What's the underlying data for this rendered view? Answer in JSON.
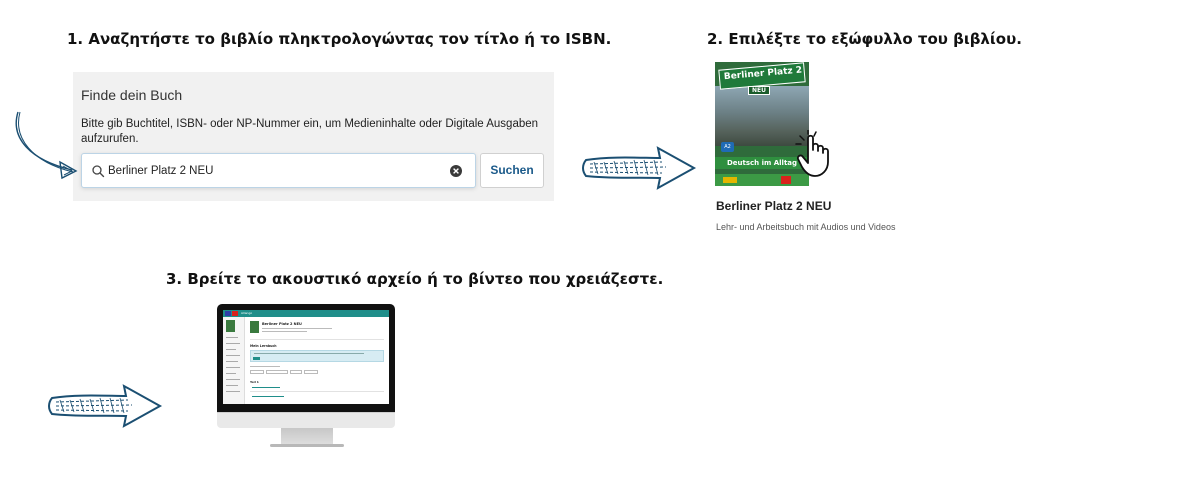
{
  "steps": {
    "step1": "1. Αναζητήστε το βιβλίο πληκτρολογώντας τον τίτλο ή το ISBN.",
    "step2": "2. Επιλέξτε το εξώφυλλο του βιβλίου.",
    "step3": "3. Βρείτε το ακουστικό αρχείο ή το βίντεο που χρειάζεστε."
  },
  "search": {
    "title": "Finde dein Buch",
    "description": "Bitte gib Buchtitel, ISBN- oder NP-Nummer ein, um Medieninhalte oder Digitale Ausgaben aufzurufen.",
    "value": "Berliner Platz 2 NEU",
    "button_label": "Suchen"
  },
  "book": {
    "cover_title": "Berliner Platz 2",
    "cover_badge": "NEU",
    "cover_level": "A2",
    "cover_subtitle": "Deutsch im Alltag",
    "name": "Berliner Platz 2 NEU",
    "description": "Lehr- und Arbeitsbuch mit Audios und Videos"
  },
  "screen": {
    "app_title": "Allango",
    "book_title": "Berliner Platz 2 NEU",
    "section_title": "Mein Lernbuch",
    "row_title": "Teil 1"
  },
  "colors": {
    "arrow": "#1b4f72",
    "accent_teal": "#1f8e8a",
    "cover_green": "#2f6b3b",
    "search_button_text": "#1b5a8a"
  },
  "icons": [
    "search-icon",
    "clear-icon",
    "hand-cursor-icon",
    "curved-arrow-icon",
    "right-arrow-icon"
  ]
}
